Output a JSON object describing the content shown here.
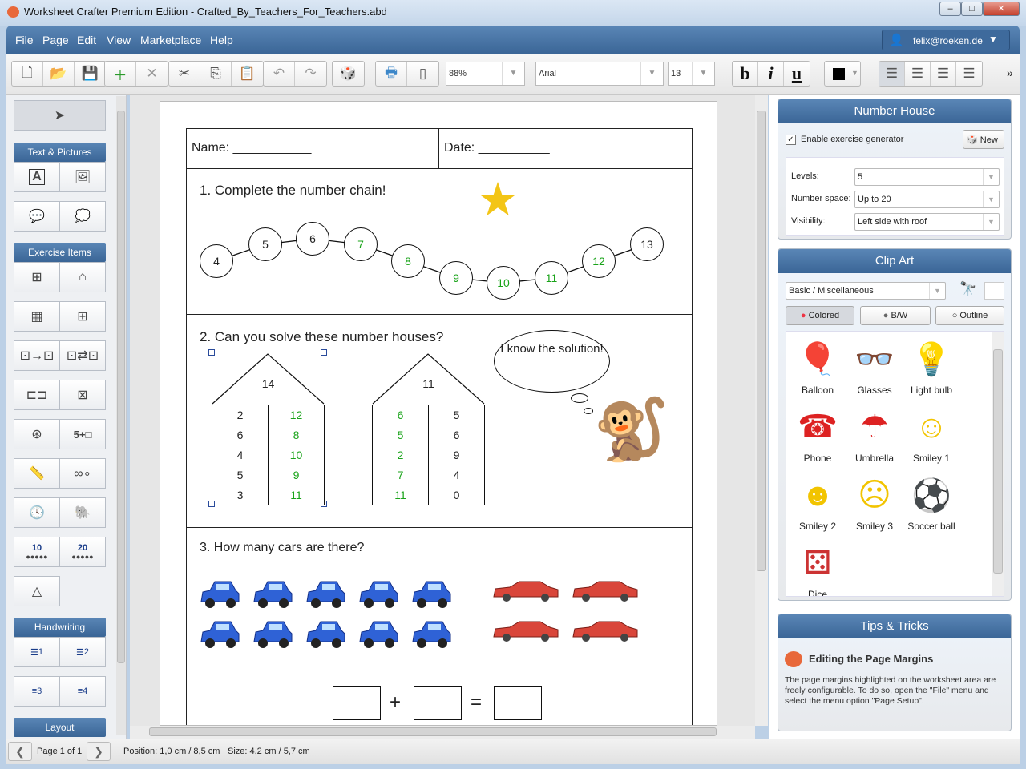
{
  "window": {
    "title": "Worksheet Crafter Premium Edition - Crafted_By_Teachers_For_Teachers.abd"
  },
  "menu": [
    "File",
    "Page",
    "Edit",
    "View",
    "Marketplace",
    "Help"
  ],
  "user": {
    "email": "felix@roeken.de"
  },
  "toolbar": {
    "zoom": "88%",
    "font": "Arial",
    "font_size": "13",
    "bold": "b",
    "italic": "i",
    "underline": "u",
    "more": "»"
  },
  "left_panel": {
    "sections": [
      "Text & Pictures",
      "Exercise Items",
      "Handwriting",
      "Layout"
    ],
    "dice_10": "10",
    "dice_20": "20",
    "plus_box": "5+□",
    "hw": [
      "1",
      "2",
      "3",
      "4"
    ]
  },
  "worksheet": {
    "name_label": "Name: ___________",
    "date_label": "Date: __________",
    "q1": "1. Complete the number chain!",
    "chain": [
      {
        "v": "4",
        "fill": false
      },
      {
        "v": "5",
        "fill": false
      },
      {
        "v": "6",
        "fill": false
      },
      {
        "v": "7",
        "fill": true
      },
      {
        "v": "8",
        "fill": true
      },
      {
        "v": "9",
        "fill": true
      },
      {
        "v": "10",
        "fill": true
      },
      {
        "v": "11",
        "fill": true
      },
      {
        "v": "12",
        "fill": true
      },
      {
        "v": "13",
        "fill": false
      }
    ],
    "q2": "2. Can you solve these number houses?",
    "bubble": "I know the solution!",
    "houses": [
      {
        "roof": "14",
        "rows": [
          [
            "2",
            "12"
          ],
          [
            "6",
            "8"
          ],
          [
            "4",
            "10"
          ],
          [
            "5",
            "9"
          ],
          [
            "3",
            "11"
          ]
        ],
        "answer_col": 1
      },
      {
        "roof": "11",
        "rows": [
          [
            "6",
            "5"
          ],
          [
            "5",
            "6"
          ],
          [
            "2",
            "9"
          ],
          [
            "7",
            "4"
          ],
          [
            "11",
            "0"
          ]
        ],
        "answer_col": 0
      }
    ],
    "q3": "3. How many cars are there?",
    "plus": "+",
    "equals": "=",
    "colors": {
      "answer": "#19a319",
      "blue_car": "#2f62d6",
      "red_car": "#d9463a"
    }
  },
  "number_house": {
    "title": "Number House",
    "enable_label": "Enable exercise generator",
    "enabled": true,
    "new_button": "New",
    "fields": [
      {
        "label": "Levels:",
        "value": "5"
      },
      {
        "label": "Number space:",
        "value": "Up to 20"
      },
      {
        "label": "Visibility:",
        "value": "Left side with roof"
      }
    ]
  },
  "clip_art": {
    "title": "Clip Art",
    "category": "Basic / Miscellaneous",
    "modes": [
      "Colored",
      "B/W",
      "Outline"
    ],
    "selected_mode": "Colored",
    "items": [
      "Balloon",
      "Glasses",
      "Light bulb",
      "Phone",
      "Umbrella",
      "Smiley 1",
      "Smiley 2",
      "Smiley 3",
      "Soccer ball",
      "Dice"
    ]
  },
  "tips": {
    "title": "Tips & Tricks",
    "heading": "Editing the Page Margins",
    "body": "The page margins highlighted on the worksheet area are freely configurable. To do so, open the \"File\" menu and select the menu option \"Page Setup\"."
  },
  "status": {
    "page": "Page 1 of 1",
    "position": "Position: 1,0 cm / 8,5 cm",
    "size": "Size: 4,2 cm / 5,7 cm"
  }
}
